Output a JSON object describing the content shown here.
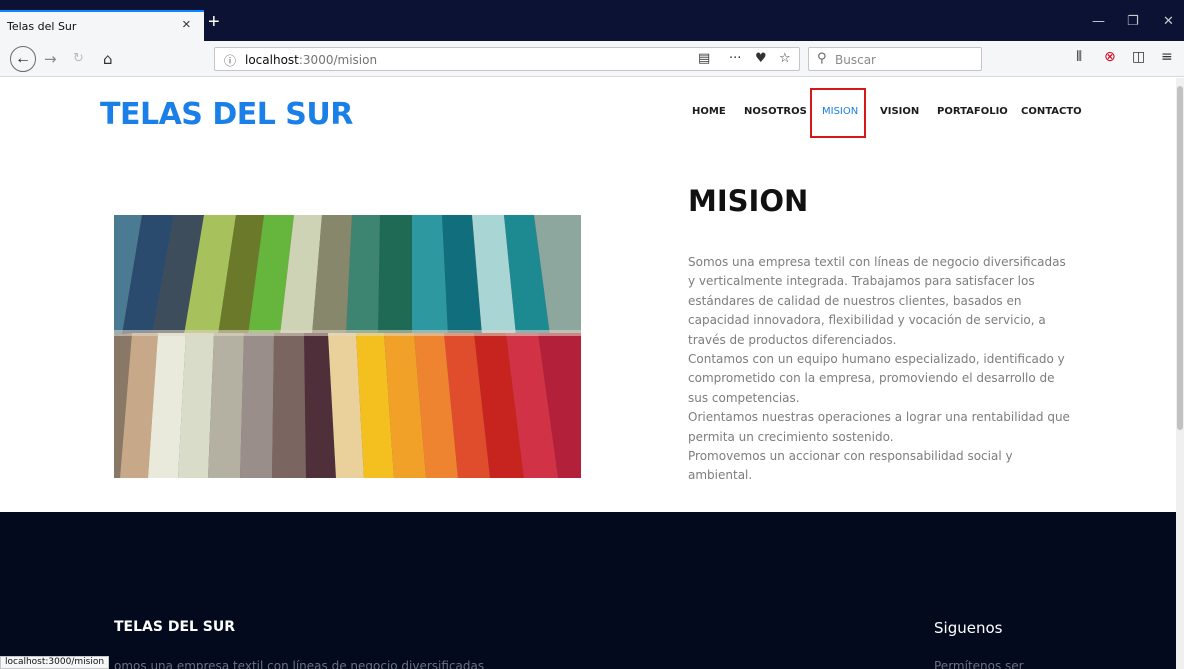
{
  "browser": {
    "tab_title": "Telas del Sur",
    "tab_close": "×",
    "new_tab": "+",
    "url_host": "localhost",
    "url_path": ":3000/mision",
    "search_placeholder": "Buscar",
    "status_url": "localhost:3000/mision"
  },
  "site": {
    "brand": "TELAS DEL SUR",
    "nav": [
      "HOME",
      "NOSOTROS",
      "MISION",
      "VISION",
      "PORTAFOLIO",
      "CONTACTO"
    ],
    "active_nav": "MISION"
  },
  "content": {
    "heading": "MISION",
    "paragraph_lines": [
      "Somos una empresa textil con líneas de negocio diversificadas",
      "y verticalmente integrada. Trabajamos para satisfacer los",
      "estándares de calidad de nuestros clientes, basados en",
      "capacidad innovadora, flexibilidad y vocación de servicio, a",
      "través de productos diferenciados.",
      "Contamos con un equipo humano especializado, identificado y",
      "comprometido con la empresa, promoviendo el desarrollo de",
      "sus competencias.",
      "Orientamos nuestras operaciones a lograr una rentabilidad que",
      "permita un crecimiento sostenido.",
      "Promovemos un accionar con responsabilidad social y",
      "ambiental."
    ]
  },
  "footer": {
    "title": "TELAS DEL SUR",
    "social_title": "Siguenos",
    "text_partial": "omos una empresa textil con líneas de negocio diversificadas",
    "social_text_partial": "Permítenos ser"
  },
  "colors": {
    "brand": "#1a7fe6",
    "footer_bg": "#030a1e",
    "active_outline": "#d81818"
  }
}
